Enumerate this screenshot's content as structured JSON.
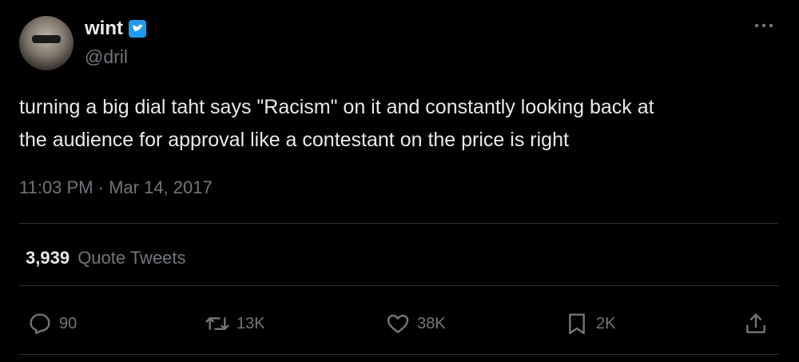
{
  "author": {
    "name": "wint",
    "handle": "@dril"
  },
  "tweet": {
    "text_line1": "turning a big dial taht says \"Racism\" on it and constantly looking back at",
    "text_line2": "the audience for approval like a contestant on the price is right",
    "time": "11:03 PM · Mar 14, 2017"
  },
  "stats": {
    "quote_count": "3,939",
    "quote_label": "Quote Tweets"
  },
  "actions": {
    "reply_count": "90",
    "retweet_count": "13K",
    "like_count": "38K",
    "bookmark_count": "2K"
  },
  "colors": {
    "background": "#000000",
    "text": "#e7e9ea",
    "muted": "#71767b",
    "verified": "#1d9bf0",
    "divider": "#2f3336"
  },
  "icons": [
    "verified-badge-icon",
    "more-icon",
    "reply-icon",
    "retweet-icon",
    "like-icon",
    "bookmark-icon",
    "share-icon"
  ]
}
